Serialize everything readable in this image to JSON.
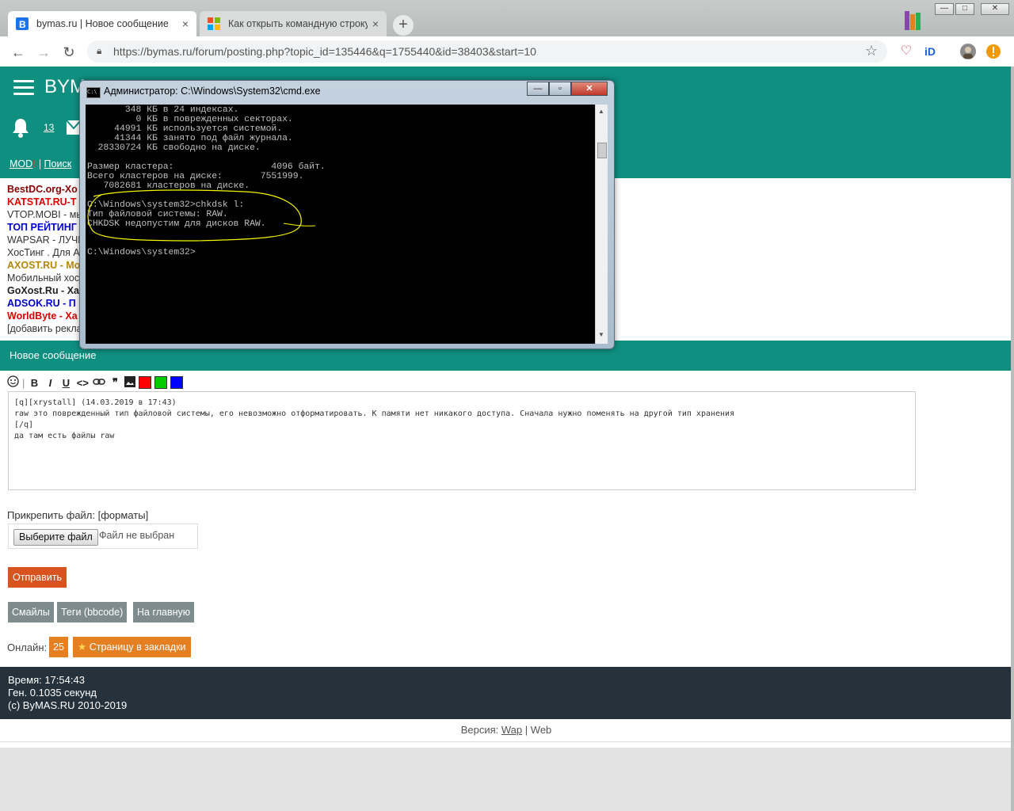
{
  "browser": {
    "tabs": [
      {
        "title": "bymas.ru | Новое сообщение",
        "close": "×"
      },
      {
        "title": "Как открыть командную строку",
        "close": "×"
      }
    ],
    "new_tab": "+",
    "url": "https://bymas.ru/forum/posting.php?topic_id=135446&q=1755440&id=38403&start=10",
    "window_buttons": {
      "minimize": "—",
      "maximize": "□",
      "close": "✕"
    }
  },
  "site": {
    "logo": "BYM",
    "notification_count": "13",
    "mod_link": "MOD",
    "mod_alert": "!",
    "separator": " | ",
    "search_link": "Поиск"
  },
  "ads": [
    {
      "text": "BestDC.org-Хо",
      "color": "#8b0000",
      "bold": true
    },
    {
      "text": "KATSTAT.RU-Т",
      "color": "#e00000",
      "bold": true
    },
    {
      "text": "VTOP.MOBI - мы",
      "color": "#333333",
      "bold": false
    },
    {
      "text": "ТОП РЕЙТИНГ",
      "color": "#0000cc",
      "bold": true
    },
    {
      "text": "WAPSAR - ЛУЧШ",
      "color": "#333333",
      "bold": false
    },
    {
      "text": "ХосТинг . Для А",
      "color": "#333333",
      "bold": false
    },
    {
      "text": "AXOST.RU - Мо",
      "color": "#b8860b",
      "bold": true
    },
    {
      "text": "Мобильный хос",
      "color": "#333333",
      "bold": false
    },
    {
      "text": "GoXost.Ru - Ха",
      "color": "#222222",
      "bold": true
    },
    {
      "text": "ADSOK.RU - П",
      "color": "#0000cc",
      "bold": true
    },
    {
      "text": "WorldByte - Ха",
      "color": "#e00000",
      "bold": true
    },
    {
      "text": "[добавить рекла",
      "color": "#333333",
      "bold": false
    }
  ],
  "editor": {
    "heading": "Новое сообщение",
    "toolbar": {
      "bold": "B",
      "italic": "I",
      "underline": "U",
      "code": "<>",
      "quote": "❞",
      "separator": "|"
    },
    "colors": [
      "#ff0000",
      "#00cc00",
      "#0000ff"
    ],
    "message_text": "[q][xrystall] (14.03.2019 в 17:43)\nraw это поврежденный тип файловой системы, его невозможно отформатировать. К памяти нет никакого доступа. Сначала нужно поменять на другой тип хранения\n[/q]\nда там есть файлы raw"
  },
  "attach": {
    "label": "Прикрепить файл: [форматы]",
    "choose_button": "Выберите файл",
    "no_file": "Файл не выбран"
  },
  "buttons": {
    "send": "Отправить",
    "smiles": "Смайлы",
    "tags": "Теги (bbcode)",
    "home": "На главную",
    "bookmark": "Страницу в закладки"
  },
  "online": {
    "label": "Онлайн:",
    "count": "25"
  },
  "footer": {
    "time": "Время: 17:54:43",
    "gen": "Ген. 0.1035 секунд",
    "copyright": "(c) ByMAS.RU 2010-2019"
  },
  "version": {
    "label": "Версия:",
    "wap": "Wap",
    "separator": "|",
    "web": "Web"
  },
  "cmd": {
    "title": "Администратор: C:\\Windows\\System32\\cmd.exe",
    "output": "       348 КБ в 24 индексах.\n         0 КБ в поврежденных секторах.\n     44991 КБ используется системой.\n     41344 КБ занято под файл журнала.\n  28330724 КБ свободно на диске.\n\nРазмер кластера:                  4096 байт.\nВсего кластеров на диске:       7551999.\n   7082681 кластеров на диске.\n\nC:\\Windows\\system32>chkdsk l:\nТип файловой системы: RAW.\nCHKDSK недопустим для дисков RAW.\n\n\nC:\\Windows\\system32>",
    "highlight_color": "#f5f500"
  }
}
